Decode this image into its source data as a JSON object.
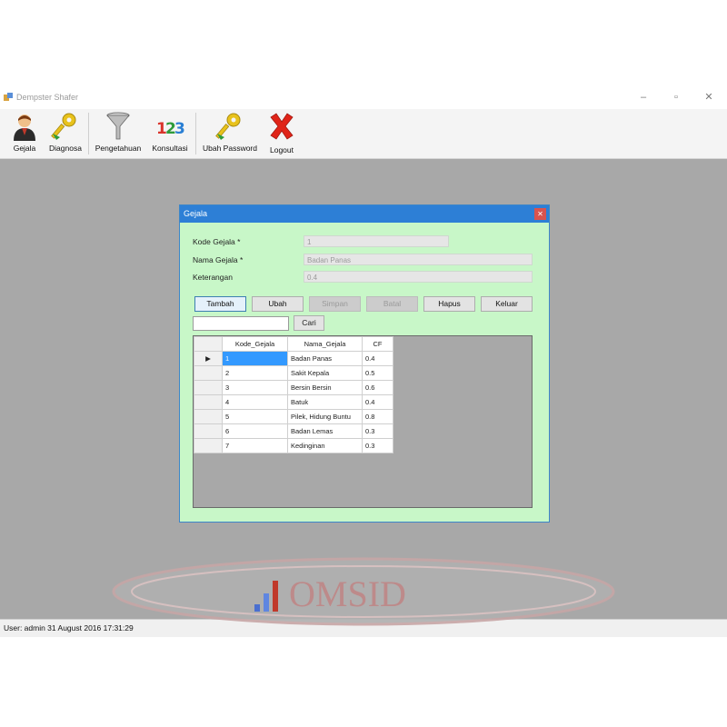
{
  "window": {
    "title": "Dempster Shafer"
  },
  "toolbar": [
    {
      "label": "Gejala",
      "icon": "user-icon"
    },
    {
      "label": "Diagnosa",
      "icon": "keys-icon"
    },
    {
      "label": "Pengetahuan",
      "icon": "funnel-icon"
    },
    {
      "label": "Konsultasi",
      "icon": "numbers-123-icon"
    },
    {
      "label": "Ubah Password",
      "icon": "keys-icon"
    },
    {
      "label": "Logout",
      "icon": "red-x-icon"
    }
  ],
  "dialog": {
    "title": "Gejala",
    "fields": {
      "kode": {
        "label": "Kode Gejala *",
        "value": "1"
      },
      "nama": {
        "label": "Nama Gejala *",
        "value": "Badan Panas"
      },
      "keterangan": {
        "label": "Keterangan",
        "value": "0.4"
      }
    },
    "buttons": {
      "tambah": "Tambah",
      "ubah": "Ubah",
      "simpan": "Simpan",
      "batal": "Batal",
      "hapus": "Hapus",
      "keluar": "Keluar"
    },
    "search": {
      "value": "",
      "button": "Cari"
    },
    "table": {
      "columns": [
        "Kode_Gejala",
        "Nama_Gejala",
        "CF"
      ],
      "rows": [
        [
          "1",
          "Badan Panas",
          "0.4"
        ],
        [
          "2",
          "Sakit Kepala",
          "0.5"
        ],
        [
          "3",
          "Bersin Bersin",
          "0.6"
        ],
        [
          "4",
          "Batuk",
          "0.4"
        ],
        [
          "5",
          "Pilek, Hidung Buntu",
          "0.8"
        ],
        [
          "6",
          "Badan Lemas",
          "0.3"
        ],
        [
          "7",
          "Kedinginan",
          "0.3"
        ]
      ],
      "current_row_marker": "▶"
    }
  },
  "status": {
    "text": "User: admin  31 August 2016 17:31:29"
  },
  "watermark": {
    "text": "OMSID"
  },
  "colors": {
    "workspace": "#a8a8a8",
    "dialog_bg": "#c8f7c8",
    "dialog_title": "#2d7fd6",
    "selection": "#3399ff"
  }
}
